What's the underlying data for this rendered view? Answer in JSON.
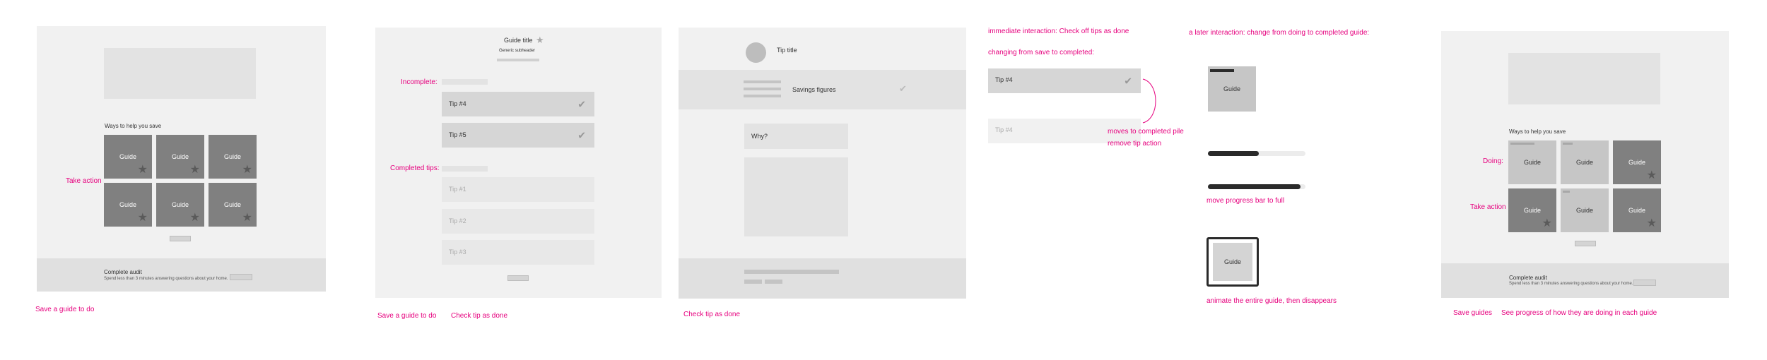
{
  "mock1": {
    "section_title": "Ways to help you save",
    "guide_label": "Guide",
    "left_annotation": "Take action",
    "audit_title": "Complete audit",
    "audit_sub": "Spend less than 3 minutes answering questions about your home.",
    "bottom_note": "Save a guide to do"
  },
  "mock2": {
    "guide_title": "Guide title",
    "subheader": "Generic subheader",
    "incomplete_label": "Incomplete:",
    "completed_label": "Completed tips:",
    "tip4": "Tip #4",
    "tip5": "Tip #5",
    "tip1": "Tip #1",
    "tip2": "Tip #2",
    "tip3": "Tip #3",
    "note_left": "Save a guide to do",
    "note_right": "Check tip as done"
  },
  "mock3": {
    "tip_title": "Tip title",
    "savings": "Savings figures",
    "why": "Why?",
    "note": "Check tip as done"
  },
  "flow1": {
    "line1": "immediate interaction: Check off tips as done",
    "line2": "changing from save to completed:",
    "tip_active": "Tip #4",
    "tip_done": "Tip #4",
    "moves": "moves to completed pile",
    "remove": "remove tip action"
  },
  "flow2": {
    "header": "a later interaction: change from doing to completed guide:",
    "guide_label": "Guide",
    "progress_note": "move progress bar to full",
    "animate_note": "animate the entire guide, then disappears",
    "progress_partial": 0.52,
    "progress_full": 0.95
  },
  "mock4": {
    "section_title": "Ways to help you save",
    "guide_label": "Guide",
    "doing_label": "Doing:",
    "take_action": "Take action",
    "audit_title": "Complete audit",
    "audit_sub": "Spend less than 3 minutes answering questions about your home.",
    "note_left": "Save guides",
    "note_right": "See progress of how they are doing in each guide"
  },
  "colors": {
    "accent": "#e6007e",
    "dark_tile": "#808080",
    "light_tile": "#c6c6c6"
  }
}
